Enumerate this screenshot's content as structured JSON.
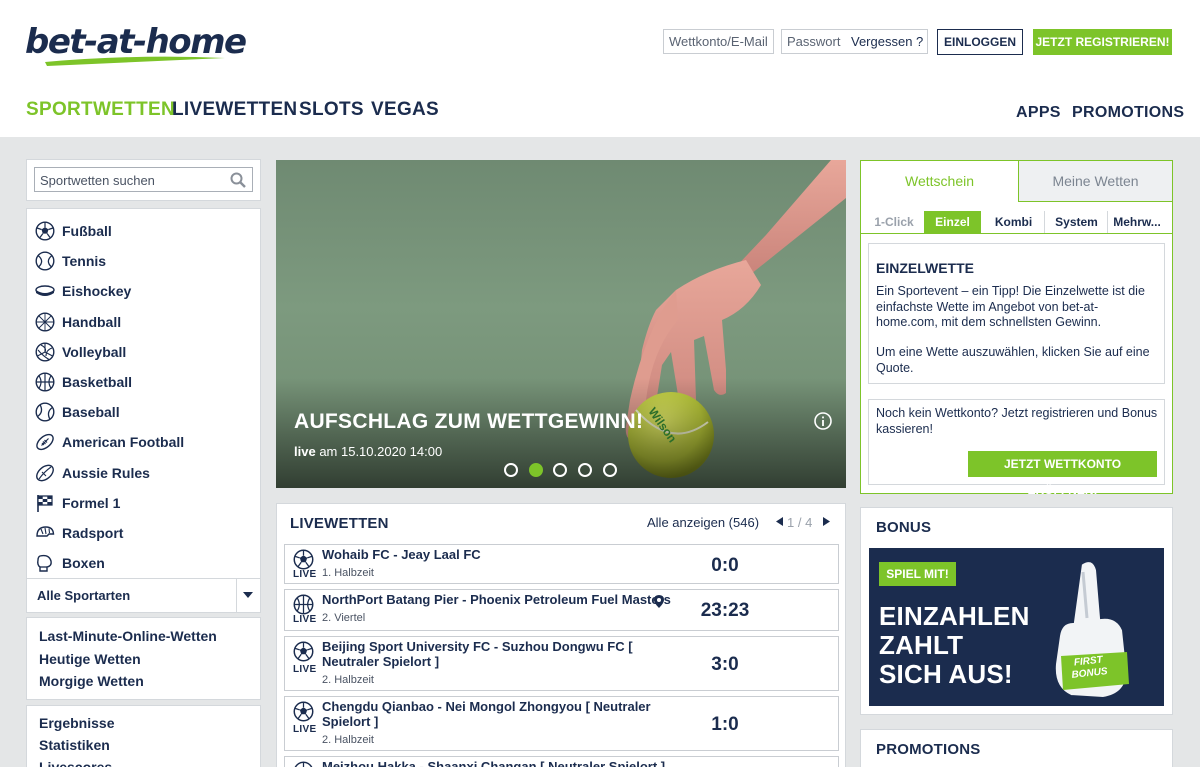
{
  "header": {
    "logo": "bet-at-home",
    "account_placeholder": "Wettkonto/E-Mail",
    "password_placeholder": "Passwort",
    "forgot_label": "Vergessen ?",
    "login_label": "EINLOGGEN",
    "register_label": "JETZT REGISTRIEREN!"
  },
  "nav": {
    "left": [
      "SPORTWETTEN",
      "LIVEWETTEN",
      "SLOTS",
      "VEGAS"
    ],
    "right": [
      "APPS",
      "PROMOTIONS"
    ],
    "active_color": "#7dc429"
  },
  "sidebar": {
    "search_placeholder": "Sportwetten suchen",
    "sports": [
      {
        "label": "Fußball",
        "icon": "soccer-ball-icon"
      },
      {
        "label": "Tennis",
        "icon": "tennis-ball-icon"
      },
      {
        "label": "Eishockey",
        "icon": "hockey-puck-icon"
      },
      {
        "label": "Handball",
        "icon": "handball-icon"
      },
      {
        "label": "Volleyball",
        "icon": "volleyball-icon"
      },
      {
        "label": "Basketball",
        "icon": "basketball-icon"
      },
      {
        "label": "Baseball",
        "icon": "baseball-icon"
      },
      {
        "label": "American Football",
        "icon": "american-football-icon"
      },
      {
        "label": "Aussie Rules",
        "icon": "aussie-rules-ball-icon"
      },
      {
        "label": "Formel 1",
        "icon": "checkered-flag-icon"
      },
      {
        "label": "Radsport",
        "icon": "cycling-helmet-icon"
      },
      {
        "label": "Boxen",
        "icon": "boxing-glove-icon"
      }
    ],
    "all_sports_label": "Alle Sportarten",
    "links_a": [
      "Last-Minute-Online-Wetten",
      "Heutige Wetten",
      "Morgige Wetten"
    ],
    "links_b": [
      "Ergebnisse",
      "Statistiken",
      "Livescores"
    ]
  },
  "hero": {
    "title": "AUFSCHLAG ZUM WETTGEWINN!",
    "live_label": "live",
    "date_text": "am 15.10.2020 14:00",
    "ball_brand": "Wilson",
    "slides": 5,
    "active_slide": 2
  },
  "livewetten": {
    "title": "LIVEWETTEN",
    "all_label": "Alle anzeigen (546)",
    "page_current": "1",
    "page_sep": "/",
    "page_total": "4",
    "live_tag": "LIVE",
    "matches": [
      {
        "teams": "Wohaib FC - Jeay Laal FC",
        "period": "1. Halbzeit",
        "score": "0:0",
        "icon": "soccer-ball-icon"
      },
      {
        "teams": "NorthPort Batang Pier - Phoenix Petroleum Fuel Masters",
        "period": "2. Viertel",
        "score": "23:23",
        "icon": "basketball-icon"
      },
      {
        "teams": "Beijing Sport University FC - Suzhou Dongwu FC [ Neutraler Spielort ]",
        "period": "2. Halbzeit",
        "score": "3:0",
        "icon": "soccer-ball-icon"
      },
      {
        "teams": "Chengdu Qianbao - Nei Mongol Zhongyou [ Neutraler Spielort ]",
        "period": "2. Halbzeit",
        "score": "1:0",
        "icon": "soccer-ball-icon"
      },
      {
        "teams": "Meizhou Hakka - Shaanxi Changan [ Neutraler Spielort ]",
        "period": "",
        "score": "",
        "icon": "soccer-ball-icon"
      }
    ]
  },
  "betslip": {
    "tabs": [
      "Wettschein",
      "Meine Wetten"
    ],
    "subtabs": [
      "1-Click",
      "Einzel",
      "Kombi",
      "System",
      "Mehrw..."
    ],
    "info_title": "EINZELWETTE",
    "info_text_1": "Ein Sportevent – ein Tipp! Die Einzelwette ist die einfachste Wette im Angebot von bet-at-home.com, mit dem schnellsten Gewinn.",
    "info_text_2": "Um eine Wette auszuwählen, klicken Sie auf eine Quote.",
    "register_text": "Noch kein Wettkonto? Jetzt registrieren und Bonus kassieren!",
    "open_account_label": "JETZT WETTKONTO ERÖFFNEN!"
  },
  "bonus": {
    "title": "BONUS",
    "play_label": "SPIEL MIT!",
    "headline": [
      "EINZAHLEN",
      "ZAHLT",
      "SICH AUS!"
    ],
    "badge": [
      "FIRST",
      "BONUS"
    ]
  },
  "promotions": {
    "title": "PROMOTIONS"
  }
}
